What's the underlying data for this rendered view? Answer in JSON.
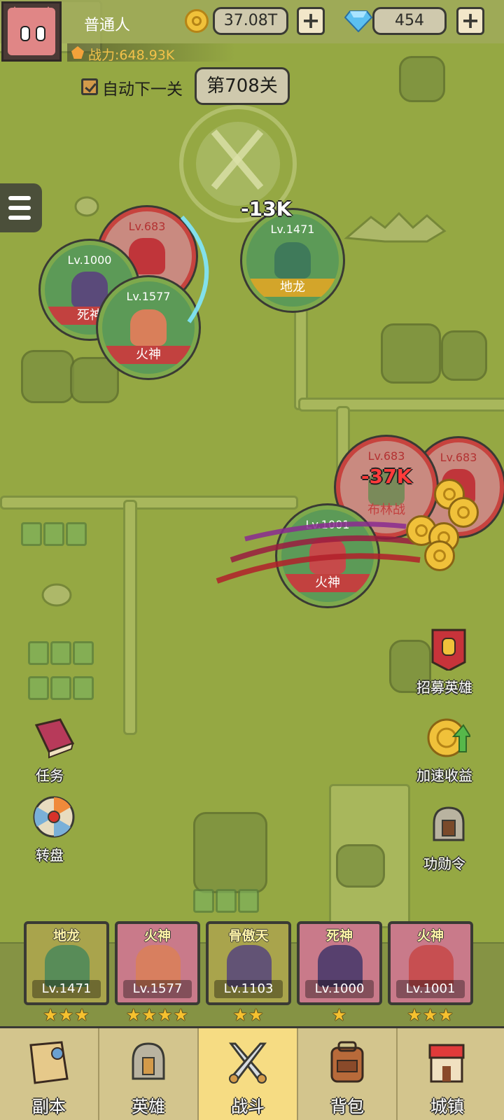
{
  "player": {
    "name": "普通人",
    "power_label": "战力:648.93K"
  },
  "currency": {
    "coins": "37.08T",
    "gems": "454",
    "plus": "+"
  },
  "stage": {
    "auto_next_label": "自动下一关",
    "auto_next_checked": true,
    "stage_label": "第708关"
  },
  "battle": {
    "units": [
      {
        "side": "enemy",
        "level": "Lv.683",
        "name": ""
      },
      {
        "side": "hero",
        "level": "Lv.1000",
        "name": "死神"
      },
      {
        "side": "hero",
        "level": "Lv.1577",
        "name": "火神"
      },
      {
        "side": "hero",
        "level": "Lv.1471",
        "name": "地龙"
      },
      {
        "side": "enemy",
        "level": "Lv.683",
        "name": "布林战"
      },
      {
        "side": "enemy",
        "level": "Lv.683",
        "name": ""
      },
      {
        "side": "hero",
        "level": "Lv.1001",
        "name": "火神"
      }
    ],
    "damage": [
      "-13K",
      "-37K"
    ]
  },
  "side_buttons": {
    "recruit": "招募英雄",
    "boost": "加速收益",
    "merit": "功勋令",
    "task": "任务",
    "wheel": "转盘"
  },
  "heroes": [
    {
      "name": "地龙",
      "level": "Lv.1471",
      "stars": "★★★"
    },
    {
      "name": "火神",
      "level": "Lv.1577",
      "stars": "★★★★"
    },
    {
      "name": "骨傲天",
      "level": "Lv.1103",
      "stars": "★★"
    },
    {
      "name": "死神",
      "level": "Lv.1000",
      "stars": "★"
    },
    {
      "name": "火神",
      "level": "Lv.1001",
      "stars": "★★★"
    }
  ],
  "nav": [
    {
      "label": "副本",
      "active": false
    },
    {
      "label": "英雄",
      "active": false
    },
    {
      "label": "战斗",
      "active": true
    },
    {
      "label": "背包",
      "active": false
    },
    {
      "label": "城镇",
      "active": false
    }
  ],
  "colors": {
    "map": "#95a843",
    "hero_ring": "#7ea94c",
    "enemy_ring": "#c7433e",
    "nav_active": "#f6dc83"
  }
}
